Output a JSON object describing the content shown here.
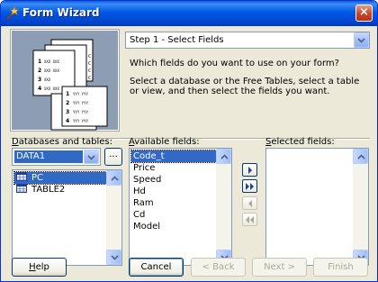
{
  "window": {
    "title": "Form Wizard",
    "close_label": "×"
  },
  "step": {
    "selected": "Step 1 - Select Fields"
  },
  "instructions": {
    "question": "Which fields do you want to use on your form?",
    "detail": "Select a database or the Free Tables, select a table or view, and then select the fields you want."
  },
  "databases": {
    "label_prefix": "",
    "label_hotkey": "D",
    "label_rest": "atabases and tables:",
    "selected_db": "DATA1",
    "browse_label": "...",
    "tables": [
      "PC",
      "TABLE2"
    ]
  },
  "available": {
    "label_hotkey": "A",
    "label_rest": "vailable fields:",
    "fields": [
      "Code_t",
      "Price",
      "Speed",
      "Hd",
      "Ram",
      "Cd",
      "Model"
    ]
  },
  "selected_fields": {
    "label_hotkey": "S",
    "label_rest": "elected fields:",
    "fields": []
  },
  "buttons": {
    "help_hotkey": "H",
    "help_rest": "elp",
    "cancel": "Cancel",
    "back": "< Back",
    "back_hotkey": "B",
    "next": "Next >",
    "finish": "Finish"
  },
  "illustration": {
    "rows_left": [
      "1",
      "2",
      "3",
      "4"
    ],
    "xxx_text": "XXX XXX",
    "yyy_text": "YYY YYY",
    "col_letters": [
      "C",
      "C",
      "C",
      "C"
    ]
  }
}
